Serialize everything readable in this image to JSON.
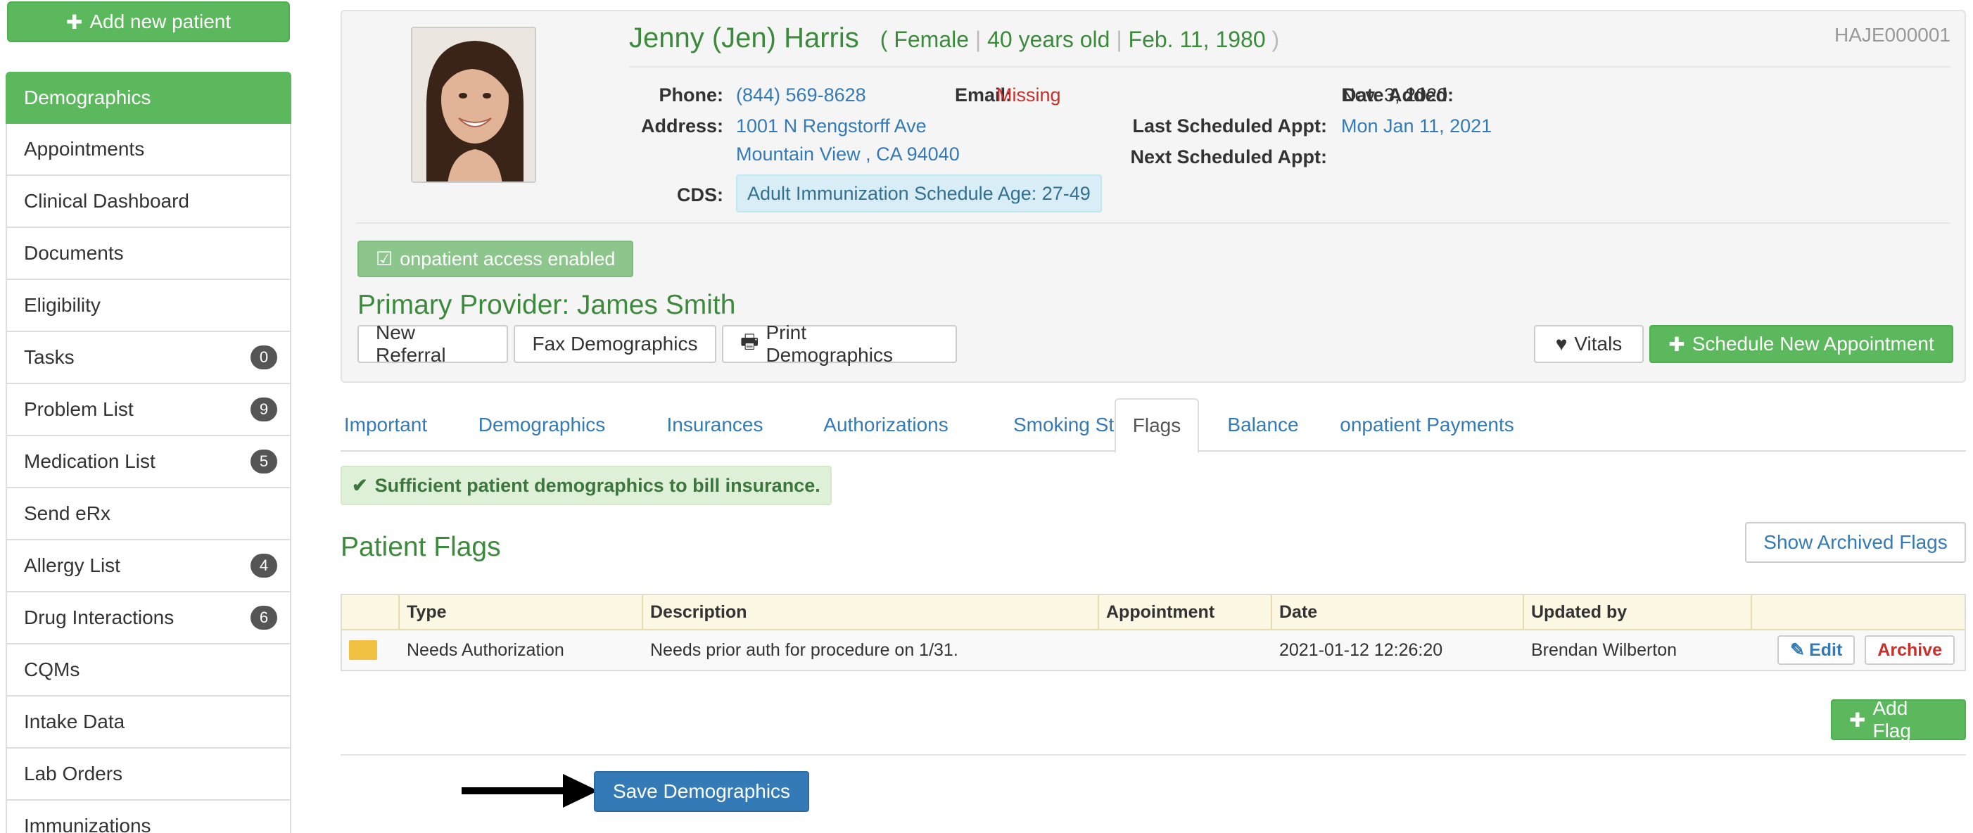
{
  "sidebar": {
    "add_patient_label": "Add new patient",
    "items": [
      {
        "label": "Demographics",
        "badge": ""
      },
      {
        "label": "Appointments",
        "badge": ""
      },
      {
        "label": "Clinical Dashboard",
        "badge": ""
      },
      {
        "label": "Documents",
        "badge": ""
      },
      {
        "label": "Eligibility",
        "badge": ""
      },
      {
        "label": "Tasks",
        "badge": "0"
      },
      {
        "label": "Problem List",
        "badge": "9"
      },
      {
        "label": "Medication List",
        "badge": "5"
      },
      {
        "label": "Send eRx",
        "badge": ""
      },
      {
        "label": "Allergy List",
        "badge": "4"
      },
      {
        "label": "Drug Interactions",
        "badge": "6"
      },
      {
        "label": "CQMs",
        "badge": ""
      },
      {
        "label": "Intake Data",
        "badge": ""
      },
      {
        "label": "Lab Orders",
        "badge": ""
      },
      {
        "label": "Immunizations",
        "badge": ""
      }
    ]
  },
  "patient": {
    "name": "Jenny (Jen) Harris",
    "paren_open": "(",
    "sex": "Female",
    "age": "40 years old",
    "dob": "Feb. 11, 1980",
    "paren_close": ")",
    "sep": "|",
    "mrn": "HAJE000001",
    "phone_label": "Phone:",
    "phone": "(844) 569-8628",
    "email_label": "Email:",
    "email": "Missing",
    "address_label": "Address:",
    "address_line1": "1001 N Rengstorff Ave",
    "address_line2": "Mountain View , CA 94040",
    "cds_label": "CDS:",
    "cds": "Adult Immunization Schedule Age: 27-49",
    "date_added_label": "Date Added:",
    "date_added": "Nov. 3, 2020",
    "last_appt_label": "Last Scheduled Appt:",
    "last_appt": "Mon Jan 11, 2021",
    "next_appt_label": "Next Scheduled Appt:",
    "next_appt": "",
    "access_label": "onpatient access enabled",
    "provider": "Primary Provider: James Smith"
  },
  "actions": {
    "new_referral": "New Referral",
    "fax": "Fax Demographics",
    "print": "Print Demographics",
    "vitals": "Vitals",
    "schedule": "Schedule New Appointment"
  },
  "tabs": [
    "Important",
    "Demographics",
    "Insurances",
    "Authorizations",
    "Smoking Status",
    "Flags",
    "Balance",
    "onpatient Payments"
  ],
  "active_tab": "Flags",
  "alert": "Sufficient patient demographics to bill insurance.",
  "flags": {
    "title": "Patient Flags",
    "show_archived": "Show Archived Flags",
    "columns": [
      "",
      "Type",
      "Description",
      "Appointment",
      "Date",
      "Updated by",
      ""
    ],
    "rows": [
      {
        "color": "#f0c040",
        "type": "Needs Authorization",
        "description": "Needs prior auth for procedure on 1/31.",
        "appointment": "",
        "date": "2021-01-12 12:26:20",
        "updated_by": "Brendan Wilberton",
        "edit": "Edit",
        "archive": "Archive"
      }
    ],
    "add_flag": "Add Flag"
  },
  "save_label": "Save Demographics",
  "colors": {
    "accent_green": "#5cb85c",
    "link_blue": "#337ab7",
    "primary_blue": "#337ab7"
  }
}
